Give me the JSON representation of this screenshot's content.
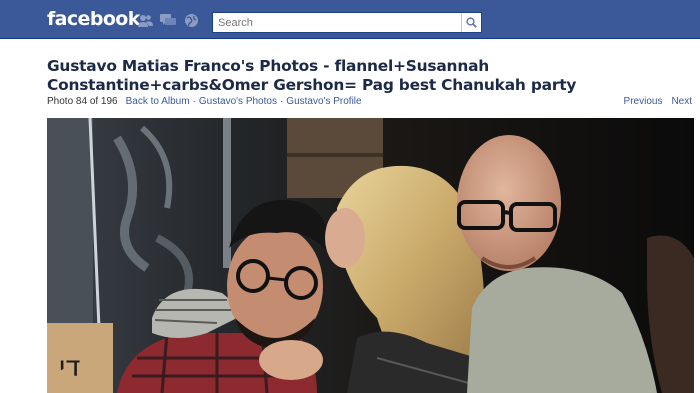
{
  "header": {
    "logo": "facebook",
    "icons": [
      "friend-requests-icon",
      "messages-icon",
      "notifications-icon"
    ],
    "search": {
      "placeholder": "Search",
      "value": ""
    }
  },
  "album": {
    "title": "Gustavo Matias Franco's Photos - flannel+Susannah Constantine+carbs&Omer Gershon= Pag best Chanukah party",
    "photo_count": "Photo 84 of 196",
    "links": {
      "back": "Back to Album",
      "photos": "Gustavo's Photos",
      "profile": "Gustavo's Profile"
    },
    "separator": "·",
    "previous": "Previous",
    "next": "Next"
  },
  "photo": {
    "description": "Party photo of three people posing together",
    "sign_text": "די"
  },
  "colors": {
    "brand": "#3b5998",
    "brand_dark": "#133783",
    "title": "#1c2a47",
    "link": "#3b5998"
  }
}
